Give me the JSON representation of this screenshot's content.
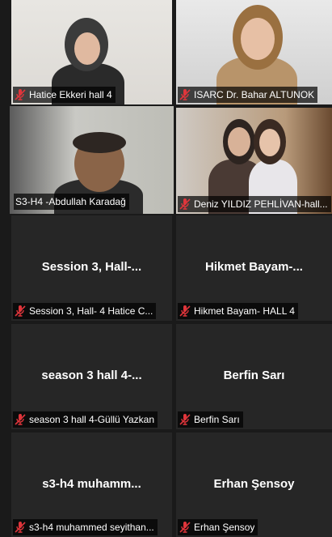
{
  "participants": [
    {
      "name": "Hatice Ekkeri hall 4",
      "muted": true,
      "video": true
    },
    {
      "name": "ISARC Dr. Bahar ALTUNOK",
      "muted": true,
      "video": true
    },
    {
      "name": "S3-H4 -Abdullah Karadağ",
      "muted": false,
      "video": true,
      "active_speaker": true
    },
    {
      "name": "Deniz YILDIZ PEHLİVAN-hall...",
      "muted": true,
      "video": true
    },
    {
      "name": "Session 3, Hall- 4 Hatice C...",
      "display": "Session 3, Hall-...",
      "muted": true,
      "video": false
    },
    {
      "name": "Hikmet Bayam- HALL 4",
      "display": "Hikmet  Bayam-...",
      "muted": true,
      "video": false
    },
    {
      "name": "season 3 hall 4-Güllü Yazkan",
      "display": "season 3 hall 4-...",
      "muted": true,
      "video": false
    },
    {
      "name": "Berfin Sarı",
      "display": "Berfin Sarı",
      "muted": true,
      "video": false
    },
    {
      "name": "s3-h4 muhammed seyithan...",
      "display": "s3-h4 muhamm...",
      "muted": true,
      "video": false
    },
    {
      "name": "Erhan Şensoy",
      "display": "Erhan Şensoy",
      "muted": true,
      "video": false
    }
  ],
  "colors": {
    "background": "#1a1a1a",
    "tile": "#262626",
    "active_border": "#e5e36a",
    "muted_icon": "#e0353b"
  },
  "icons": {
    "muted": "microphone-muted-icon"
  }
}
